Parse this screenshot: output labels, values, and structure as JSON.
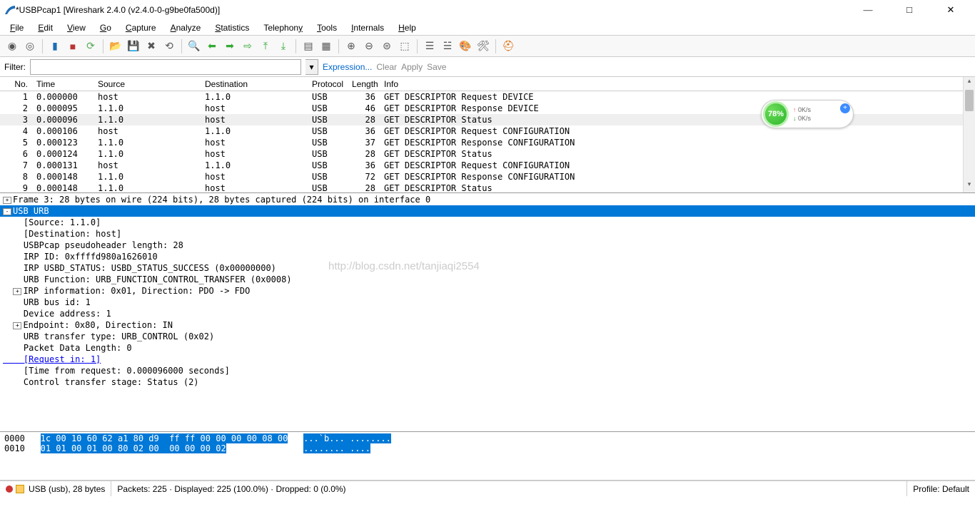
{
  "window": {
    "title": "*USBPcap1 [Wireshark 2.4.0 (v2.4.0-0-g9be0fa500d)]"
  },
  "menu": [
    "File",
    "Edit",
    "View",
    "Go",
    "Capture",
    "Analyze",
    "Statistics",
    "Telephony",
    "Tools",
    "Internals",
    "Help"
  ],
  "filter": {
    "label": "Filter:",
    "value": "",
    "expression": "Expression...",
    "clear": "Clear",
    "apply": "Apply",
    "save": "Save"
  },
  "packet_headers": [
    "No.",
    "Time",
    "Source",
    "Destination",
    "Protocol",
    "Length",
    "Info"
  ],
  "packets": [
    {
      "no": "1",
      "time": "0.000000",
      "src": "host",
      "dst": "1.1.0",
      "proto": "USB",
      "len": "36",
      "info": "GET DESCRIPTOR Request DEVICE"
    },
    {
      "no": "2",
      "time": "0.000095",
      "src": "1.1.0",
      "dst": "host",
      "proto": "USB",
      "len": "46",
      "info": "GET DESCRIPTOR Response DEVICE"
    },
    {
      "no": "3",
      "time": "0.000096",
      "src": "1.1.0",
      "dst": "host",
      "proto": "USB",
      "len": "28",
      "info": "GET DESCRIPTOR Status",
      "sel": true
    },
    {
      "no": "4",
      "time": "0.000106",
      "src": "host",
      "dst": "1.1.0",
      "proto": "USB",
      "len": "36",
      "info": "GET DESCRIPTOR Request CONFIGURATION"
    },
    {
      "no": "5",
      "time": "0.000123",
      "src": "1.1.0",
      "dst": "host",
      "proto": "USB",
      "len": "37",
      "info": "GET DESCRIPTOR Response CONFIGURATION"
    },
    {
      "no": "6",
      "time": "0.000124",
      "src": "1.1.0",
      "dst": "host",
      "proto": "USB",
      "len": "28",
      "info": "GET DESCRIPTOR Status"
    },
    {
      "no": "7",
      "time": "0.000131",
      "src": "host",
      "dst": "1.1.0",
      "proto": "USB",
      "len": "36",
      "info": "GET DESCRIPTOR Request CONFIGURATION"
    },
    {
      "no": "8",
      "time": "0.000148",
      "src": "1.1.0",
      "dst": "host",
      "proto": "USB",
      "len": "72",
      "info": "GET DESCRIPTOR Response CONFIGURATION"
    },
    {
      "no": "9",
      "time": "0.000148",
      "src": "1.1.0",
      "dst": "host",
      "proto": "USB",
      "len": "28",
      "info": "GET DESCRIPTOR Status"
    }
  ],
  "details": {
    "frame_line": "Frame 3: 28 bytes on wire (224 bits), 28 bytes captured (224 bits) on interface 0",
    "usb_urb": "USB URB",
    "lines": [
      "    [Source: 1.1.0]",
      "    [Destination: host]",
      "    USBPcap pseudoheader length: 28",
      "    IRP ID: 0xffffd980a1626010",
      "    IRP USBD_STATUS: USBD_STATUS_SUCCESS (0x00000000)",
      "    URB Function: URB_FUNCTION_CONTROL_TRANSFER (0x0008)"
    ],
    "irp_info": "IRP information: 0x01, Direction: PDO -> FDO",
    "lines2": [
      "    URB bus id: 1",
      "    Device address: 1"
    ],
    "endpoint": "Endpoint: 0x80, Direction: IN",
    "lines3": [
      "    URB transfer type: URB_CONTROL (0x02)",
      "    Packet Data Length: 0"
    ],
    "request_in": "    [Request in: 1]",
    "lines4": [
      "    [Time from request: 0.000096000 seconds]",
      "    Control transfer stage: Status (2)"
    ]
  },
  "hex": {
    "r0_off": "0000",
    "r0_hex": "1c 00 10 60 62 a1 80 d9  ff ff 00 00 00 00 08 00",
    "r0_asc": "...`b... ........",
    "r1_off": "0010",
    "r1_hex": "01 01 00 01 00 80 02 00  00 00 00 02",
    "r1_asc": "........ ...."
  },
  "status": {
    "left": "USB (usb), 28 bytes",
    "mid": "Packets: 225 · Displayed: 225 (100.0%) · Dropped: 0 (0.0%)",
    "right": "Profile: Default"
  },
  "widget": {
    "pct": "78%",
    "up": "0K/s",
    "down": "0K/s"
  },
  "watermark": "http://blog.csdn.net/tanjiaqi2554"
}
